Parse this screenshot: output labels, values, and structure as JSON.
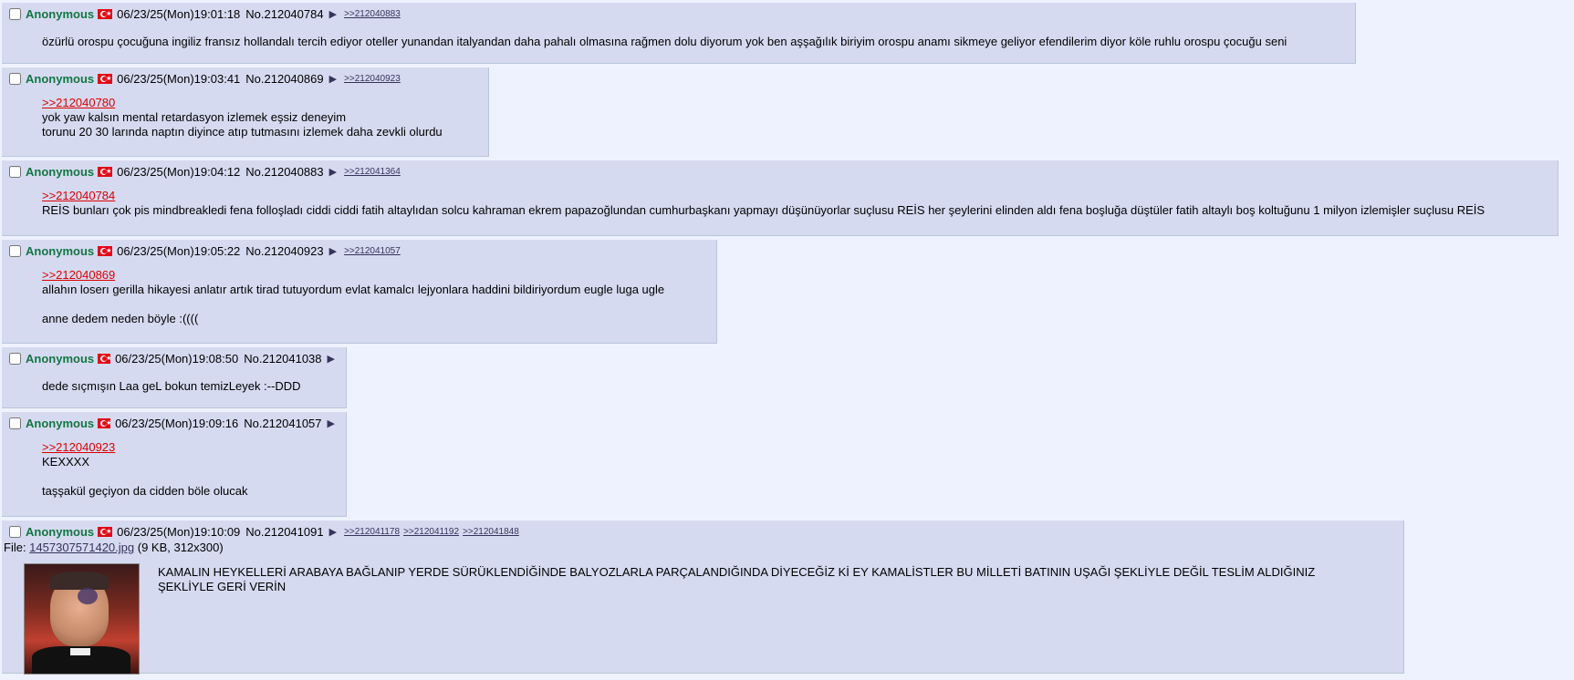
{
  "posts": [
    {
      "name": "Anonymous",
      "flag": "turkey-flag",
      "datetime": "06/23/25(Mon)19:01:18",
      "no": "No.212040784",
      "arrow": "▶",
      "backlinks": [
        ">>212040883"
      ],
      "lines": [
        "özürlü orospu çocuğuna ingiliz fransız hollandalı tercih ediyor oteller yunandan italyandan daha pahalı olmasına rağmen dolu diyorum yok ben aşşağılık biriyim orospu anamı sikmeye geliyor efendilerim diyor köle ruhlu orospu çocuğu seni"
      ]
    },
    {
      "name": "Anonymous",
      "flag": "turkey-flag",
      "datetime": "06/23/25(Mon)19:03:41",
      "no": "No.212040869",
      "arrow": "▶",
      "backlinks": [
        ">>212040923"
      ],
      "quote": ">>212040780",
      "lines": [
        "yok yaw kalsın mental retardasyon izlemek eşsiz deneyim",
        "torunu 20 30 larında naptın diyince atıp tutmasını izlemek daha zevkli olurdu"
      ]
    },
    {
      "name": "Anonymous",
      "flag": "turkey-flag",
      "datetime": "06/23/25(Mon)19:04:12",
      "no": "No.212040883",
      "arrow": "▶",
      "backlinks": [
        ">>212041364"
      ],
      "quote": ">>212040784",
      "lines": [
        "REİS bunları çok pis mindbreakledi fena folloşladı ciddi ciddi fatih altaylıdan solcu kahraman ekrem papazoğlundan cumhurbaşkanı yapmayı düşünüyorlar suçlusu REİS her şeylerini elinden aldı fena boşluğa düştüler fatih altaylı boş koltuğunu 1 milyon izlemişler suçlusu REİS"
      ]
    },
    {
      "name": "Anonymous",
      "flag": "turkey-flag",
      "datetime": "06/23/25(Mon)19:05:22",
      "no": "No.212040923",
      "arrow": "▶",
      "backlinks": [
        ">>212041057"
      ],
      "quote": ">>212040869",
      "lines": [
        "allahın loserı gerilla hikayesi anlatır artık tirad tutuyordum evlat kamalcı lejyonlara haddini bildiriyordum eugle luga ugle",
        "",
        "anne dedem neden böyle :(((("
      ]
    },
    {
      "name": "Anonymous",
      "flag": "turkey-flag",
      "datetime": "06/23/25(Mon)19:08:50",
      "no": "No.212041038",
      "arrow": "▶",
      "backlinks": [],
      "lines": [
        "dede sıçmışın Laa geL bokun temizLeyek :--DDD"
      ]
    },
    {
      "name": "Anonymous",
      "flag": "turkey-flag",
      "datetime": "06/23/25(Mon)19:09:16",
      "no": "No.212041057",
      "arrow": "▶",
      "backlinks": [],
      "quote": ">>212040923",
      "lines": [
        "KEXXXX",
        "",
        "taşşakül geçiyon da cidden böle olucak"
      ]
    },
    {
      "name": "Anonymous",
      "flag": "turkey-flag",
      "datetime": "06/23/25(Mon)19:10:09",
      "no": "No.212041091",
      "arrow": "▶",
      "backlinks": [
        ">>212041178",
        ">>212041192",
        ">>212041848"
      ],
      "file_label": "File: ",
      "file_name": "1457307571420.jpg",
      "file_meta": " (9 KB, 312x300)",
      "lines": [
        "KAMALIN HEYKELLERİ ARABAYA BAĞLANIP YERDE SÜRÜKLENDİĞİNDE BALYOZLARLA PARÇALANDIĞINDA DİYECEĞİZ Kİ EY KAMALİSTLER BU MİLLETİ BATININ UŞAĞI ŞEKLİYLE DEĞİL TESLİM ALDIĞINIZ ŞEKLİYLE GERİ VERİN"
      ]
    }
  ]
}
